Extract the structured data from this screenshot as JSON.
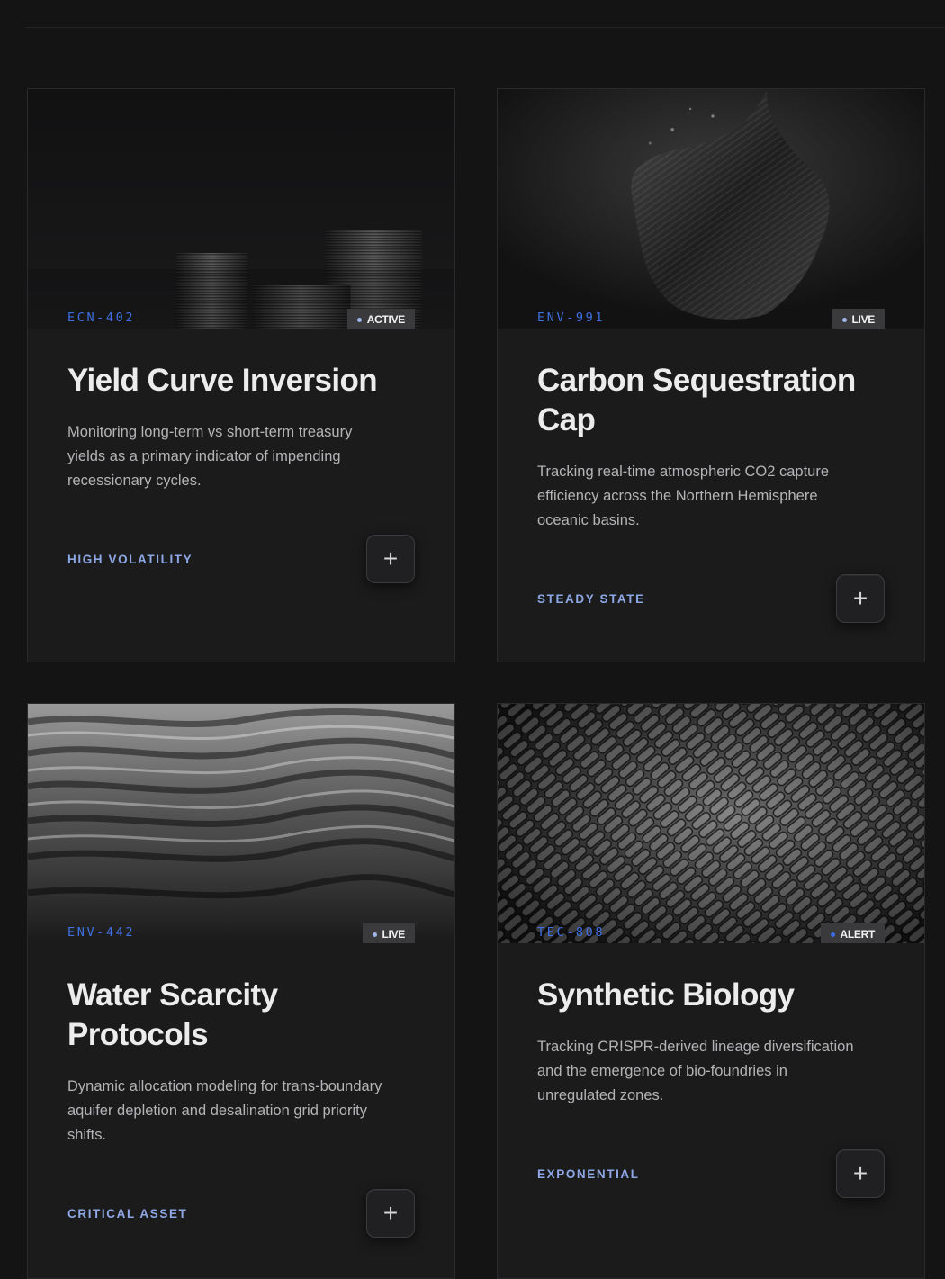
{
  "cards": [
    {
      "code": "ECN-402",
      "badge": "ACTIVE",
      "title": "Yield Curve Inversion",
      "description": "Monitoring long-term vs short-term treasury yields as a primary indicator of impending recessionary cycles.",
      "tag": "HIGH VOLATILITY",
      "action": "+",
      "image_subject": "stacked-coins"
    },
    {
      "code": "ENV-991",
      "badge": "LIVE",
      "title": "Carbon Sequestration Cap",
      "description": "Tracking real-time atmospheric CO2 capture efficiency across the Northern Hemisphere oceanic basins.",
      "tag": "STEADY STATE",
      "action": "+",
      "image_subject": "organic-sculpture"
    },
    {
      "code": "ENV-442",
      "badge": "LIVE",
      "title": "Water Scarcity Protocols",
      "description": "Dynamic allocation modeling for trans-boundary aquifer depletion and desalination grid priority shifts.",
      "tag": "CRITICAL ASSET",
      "action": "+",
      "image_subject": "water-ripples"
    },
    {
      "code": "TEC-808",
      "badge": "ALERT",
      "title": "Synthetic Biology",
      "description": "Tracking CRISPR-derived lineage diversification and the emergence of bio-foundries in unregulated zones.",
      "tag": "EXPONENTIAL",
      "action": "+",
      "image_subject": "cell-texture"
    }
  ],
  "colors": {
    "background": "#141414",
    "card": "#1b1b1c",
    "accent_code": "#3f6fe0",
    "accent_tag": "#8ea8e6",
    "badge_bg": "#3a3a3c"
  }
}
